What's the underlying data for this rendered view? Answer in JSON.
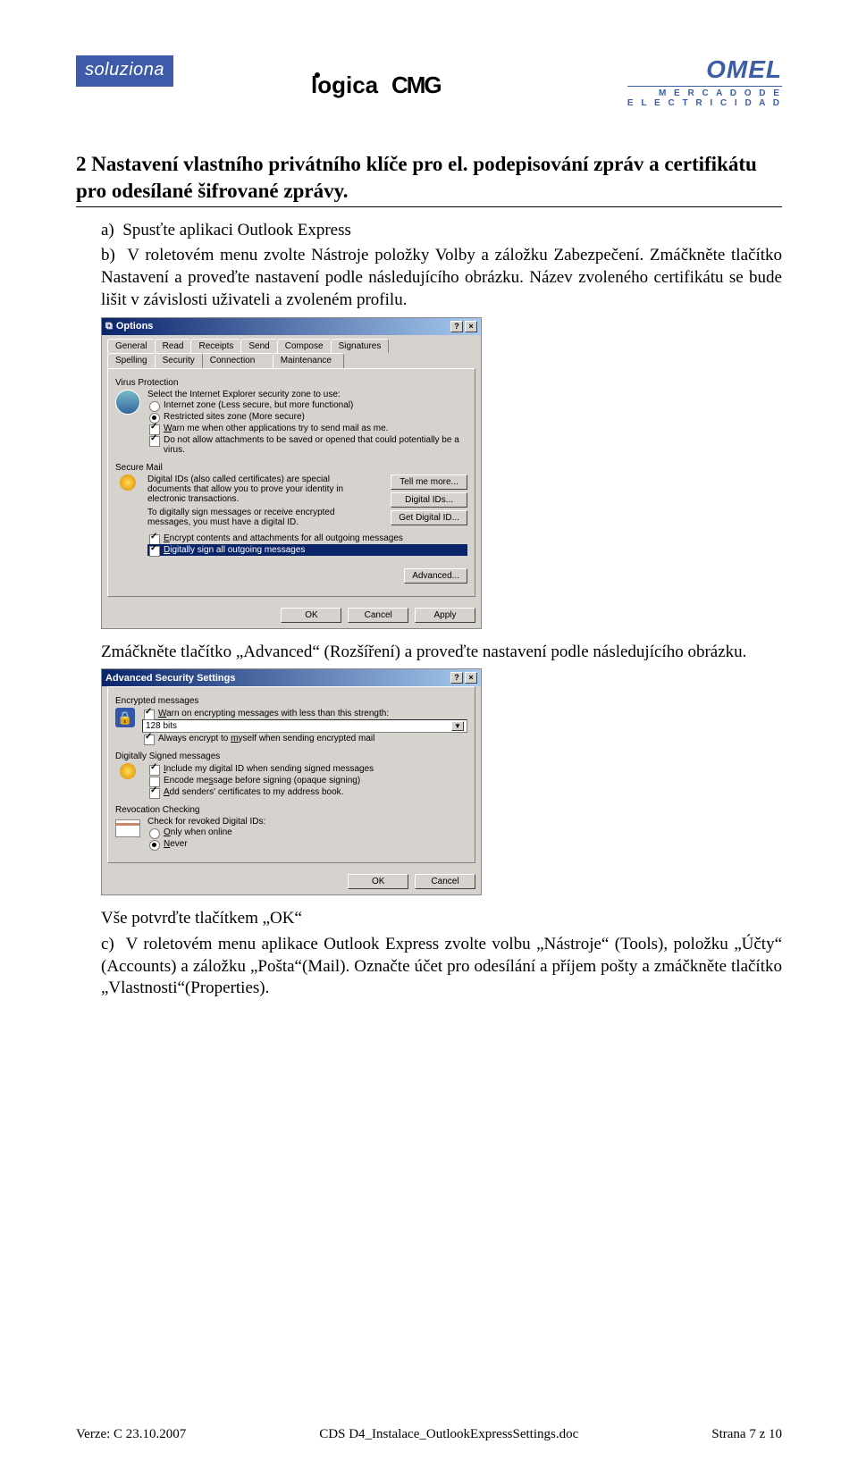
{
  "logos": {
    "soluziona": "soluziona",
    "center": "logicaCMG",
    "omel_top": "OMEL",
    "omel_sub1": "M E R C A D O   D E",
    "omel_sub2": "E L E C T R I C I D A D"
  },
  "section": {
    "heading": "2 Nastavení vlastního privátního klíče pro el. podepisování zpráv a certifikátu pro odesílané šifrované zprávy.",
    "item_a": "a)  Spusťte aplikaci Outlook Express",
    "item_b": "b)  V roletovém menu zvolte Nástroje položky Volby a záložku Zabezpečení. Zmáčkněte tlačítko Nastavení a proveďte nastavení podle následujícího obrázku. Název   zvoleného certifikátu se bude lišit v závislosti uživateli a zvoleném profilu.",
    "after_options": "Zmáčkněte tlačítko „Advanced“ (Rozšíření) a proveďte nastavení podle následujícího obrázku.",
    "after_adv_1": "Vše potvrďte tlačítkem „OK“",
    "item_c": "c)  V roletovém menu aplikace Outlook Express zvolte volbu „Nástroje“ (Tools), položku „Účty“ (Accounts) a záložku „Pošta“(Mail). Označte účet pro odesílání a příjem pošty a zmáčkněte tlačítko „Vlastnosti“(Properties)."
  },
  "dialog_options": {
    "title": "Options",
    "tabs_row1": [
      "General",
      "Read",
      "Receipts",
      "Send",
      "Compose",
      "Signatures"
    ],
    "tabs_row2": [
      "Spelling",
      "Security",
      "Connection",
      "Maintenance"
    ],
    "active_tab": "Security",
    "virusProtection": {
      "label": "Virus Protection",
      "desc": "Select the Internet Explorer security zone to use:",
      "radio1": "Internet zone (Less secure, but more functional)",
      "radio2": "Restricted sites zone (More secure)",
      "chk1": "Warn me when other applications try to send mail as me.",
      "chk2": "Do not allow attachments to be saved or opened that could potentially be a virus."
    },
    "secureMail": {
      "label": "Secure Mail",
      "desc": "Digital IDs (also called certificates) are special documents that allow you to prove your identity in electronic transactions.",
      "desc2": "To digitally sign messages or receive encrypted messages, you must have a digital ID.",
      "btn1": "Tell me more...",
      "btn2": "Digital IDs...",
      "btn3": "Get Digital ID...",
      "chk1": "Encrypt contents and attachments for all outgoing messages",
      "chk2": "Digitally sign all outgoing messages",
      "btnAdv": "Advanced..."
    },
    "btn_ok": "OK",
    "btn_cancel": "Cancel",
    "btn_apply": "Apply"
  },
  "dialog_adv": {
    "title": "Advanced Security Settings",
    "enc": {
      "label": "Encrypted messages",
      "chk1": "Warn on encrypting messages with less than this strength:",
      "select": "128 bits",
      "chk2": "Always encrypt to myself when sending encrypted mail"
    },
    "signed": {
      "label": "Digitally Signed messages",
      "chk1": "Include my digital ID when sending signed messages",
      "chk2": "Encode message before signing (opaque signing)",
      "chk3": "Add senders' certificates to my address book."
    },
    "revoc": {
      "label": "Revocation Checking",
      "desc": "Check for revoked Digital IDs:",
      "radio1": "Only when online",
      "radio2": "Never"
    },
    "btn_ok": "OK",
    "btn_cancel": "Cancel"
  },
  "footer": {
    "left": "Verze: C   23.10.2007",
    "center": "CDS D4_Instalace_OutlookExpressSettings.doc",
    "right": "Strana 7 z 10"
  }
}
